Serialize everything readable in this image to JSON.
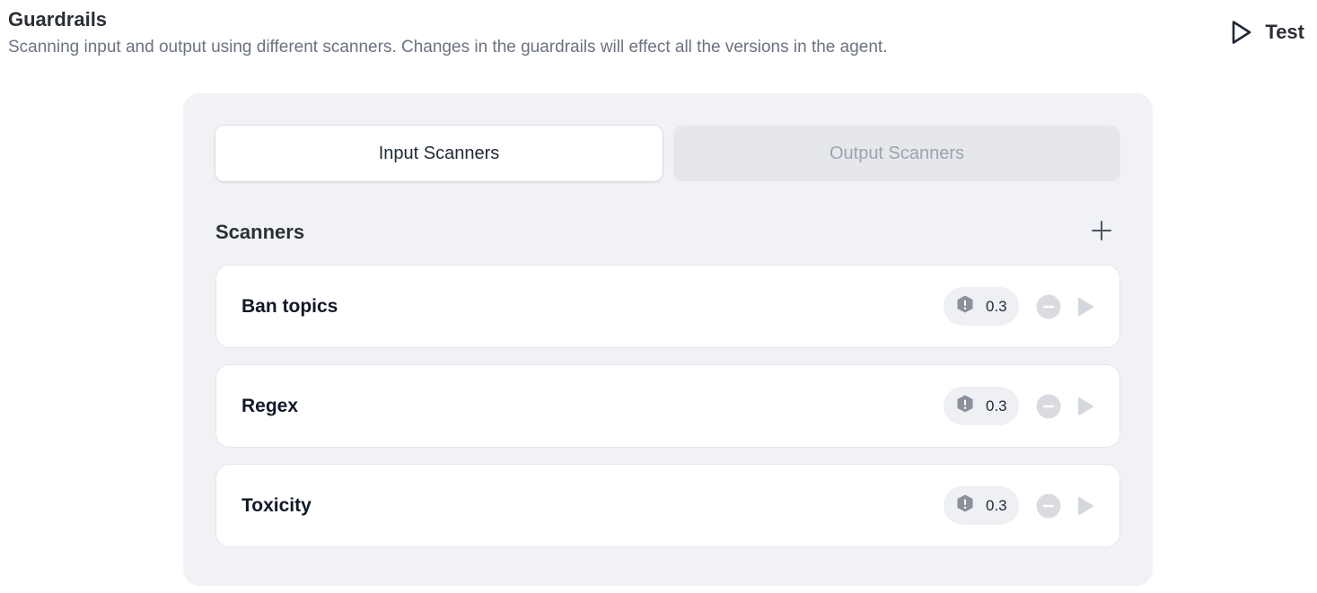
{
  "header": {
    "title": "Guardrails",
    "subtitle": "Scanning input and output using different scanners. Changes in the guardrails will effect all the versions in the agent.",
    "test_label": "Test"
  },
  "tabs": [
    {
      "label": "Input Scanners",
      "active": true
    },
    {
      "label": "Output Scanners",
      "active": false
    }
  ],
  "scanners_section": {
    "title": "Scanners",
    "items": [
      {
        "name": "Ban topics",
        "threshold": "0.3"
      },
      {
        "name": "Regex",
        "threshold": "0.3"
      },
      {
        "name": "Toxicity",
        "threshold": "0.3"
      }
    ]
  },
  "icons": {
    "test": "play-outline-icon",
    "add": "plus-icon",
    "threshold": "shield-alert-icon",
    "remove": "minus-circle-icon",
    "run": "play-icon"
  },
  "colors": {
    "panel_bg": "#f1f2f5",
    "inactive_tab_bg": "#e6e7eb",
    "muted_text": "#9ca3af",
    "title_text": "#2b2f36"
  }
}
